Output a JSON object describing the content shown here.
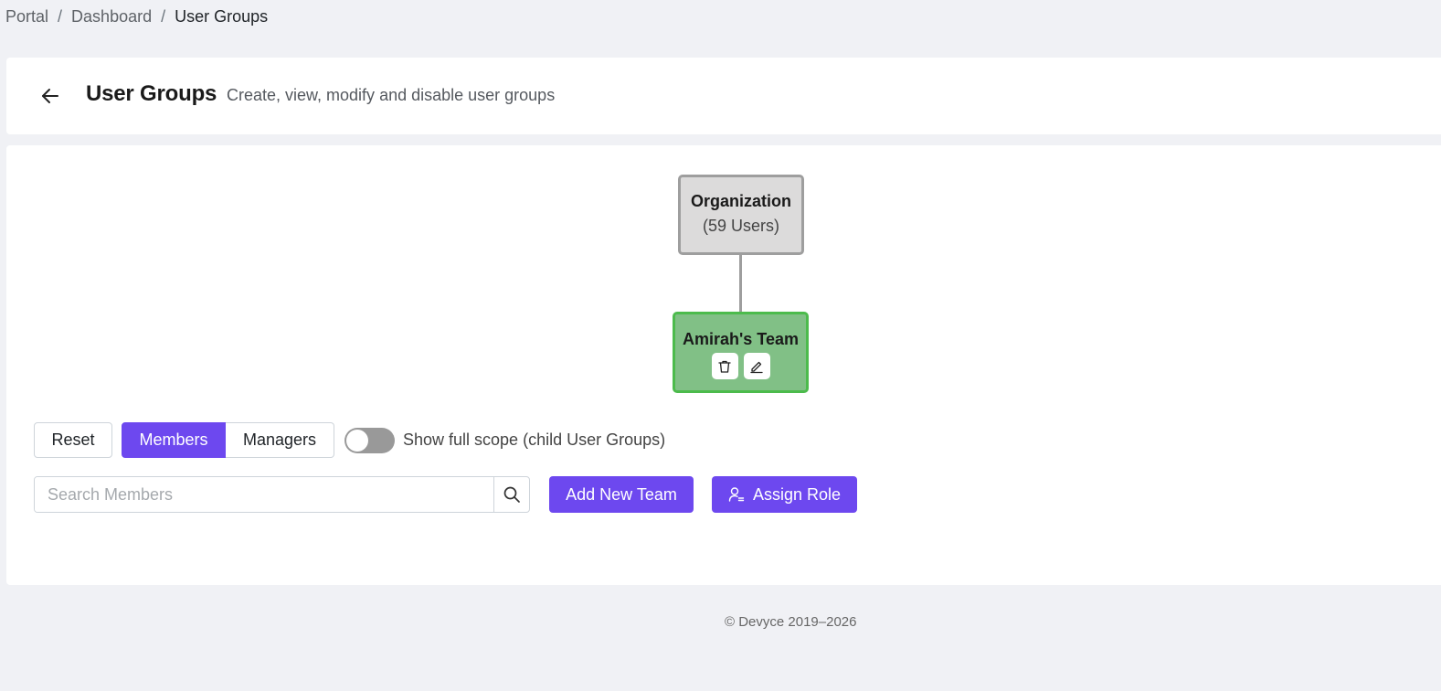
{
  "breadcrumb": {
    "items": [
      "Portal",
      "Dashboard",
      "User Groups"
    ],
    "separator": "/"
  },
  "header": {
    "back_icon": "arrow-left-icon",
    "title": "User Groups",
    "subtitle": "Create, view, modify and disable user groups"
  },
  "tree": {
    "root": {
      "name": "Organization",
      "count_label": "(59 Users)"
    },
    "child": {
      "name": "Amirah's Team",
      "actions": [
        "trash-icon",
        "pencil-icon"
      ]
    }
  },
  "controls": {
    "reset_label": "Reset",
    "view_options": [
      "Members",
      "Managers"
    ],
    "selected_view": "Members",
    "toggle_on": false,
    "toggle_label": "Show full scope (child User Groups)"
  },
  "search": {
    "placeholder": "Search Members",
    "value": ""
  },
  "actions": {
    "add_team_label": "Add New Team",
    "assign_role_label": "Assign Role"
  },
  "footer": {
    "copyright": "© Devyce 2019–2026"
  },
  "colors": {
    "primary": "#6d48ef",
    "team_node_fill": "#81c086",
    "team_node_border": "#4cbb4c",
    "root_node_fill": "#dcdbdb",
    "page_bg": "#f0f1f5"
  }
}
